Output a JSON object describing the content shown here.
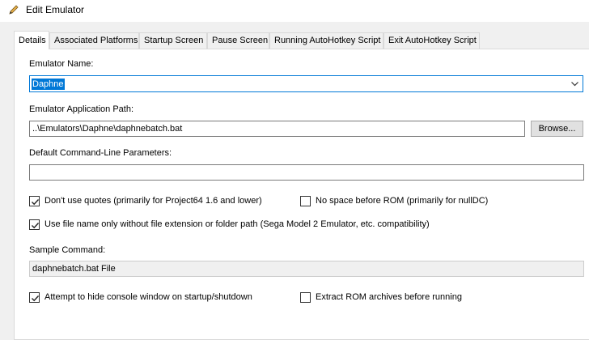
{
  "window": {
    "title": "Edit Emulator"
  },
  "tabs": [
    {
      "label": "Details",
      "active": true
    },
    {
      "label": "Associated Platforms",
      "active": false
    },
    {
      "label": "Startup Screen",
      "active": false
    },
    {
      "label": "Pause Screen",
      "active": false
    },
    {
      "label": "Running AutoHotkey Script",
      "active": false
    },
    {
      "label": "Exit AutoHotkey Script",
      "active": false
    }
  ],
  "form": {
    "name_label": "Emulator Name:",
    "name_value": "Daphne",
    "path_label": "Emulator Application Path:",
    "path_value": "..\\Emulators\\Daphne\\daphnebatch.bat",
    "browse_label": "Browse...",
    "params_label": "Default Command-Line Parameters:",
    "params_value": "",
    "sample_label": "Sample Command:",
    "sample_value": "daphnebatch.bat File"
  },
  "checkboxes": {
    "no_quotes": {
      "label": "Don't use quotes (primarily for Project64 1.6 and lower)",
      "checked": true
    },
    "no_space": {
      "label": "No space before ROM (primarily for nullDC)",
      "checked": false
    },
    "file_name_only": {
      "label": "Use file name only without file extension or folder path (Sega Model 2 Emulator, etc. compatibility)",
      "checked": true
    },
    "hide_console": {
      "label": "Attempt to hide console window on startup/shutdown",
      "checked": true
    },
    "extract_rom": {
      "label": "Extract ROM archives before running",
      "checked": false
    }
  },
  "colors": {
    "accent": "#0078d7",
    "window_bg": "#f0f0f0"
  }
}
